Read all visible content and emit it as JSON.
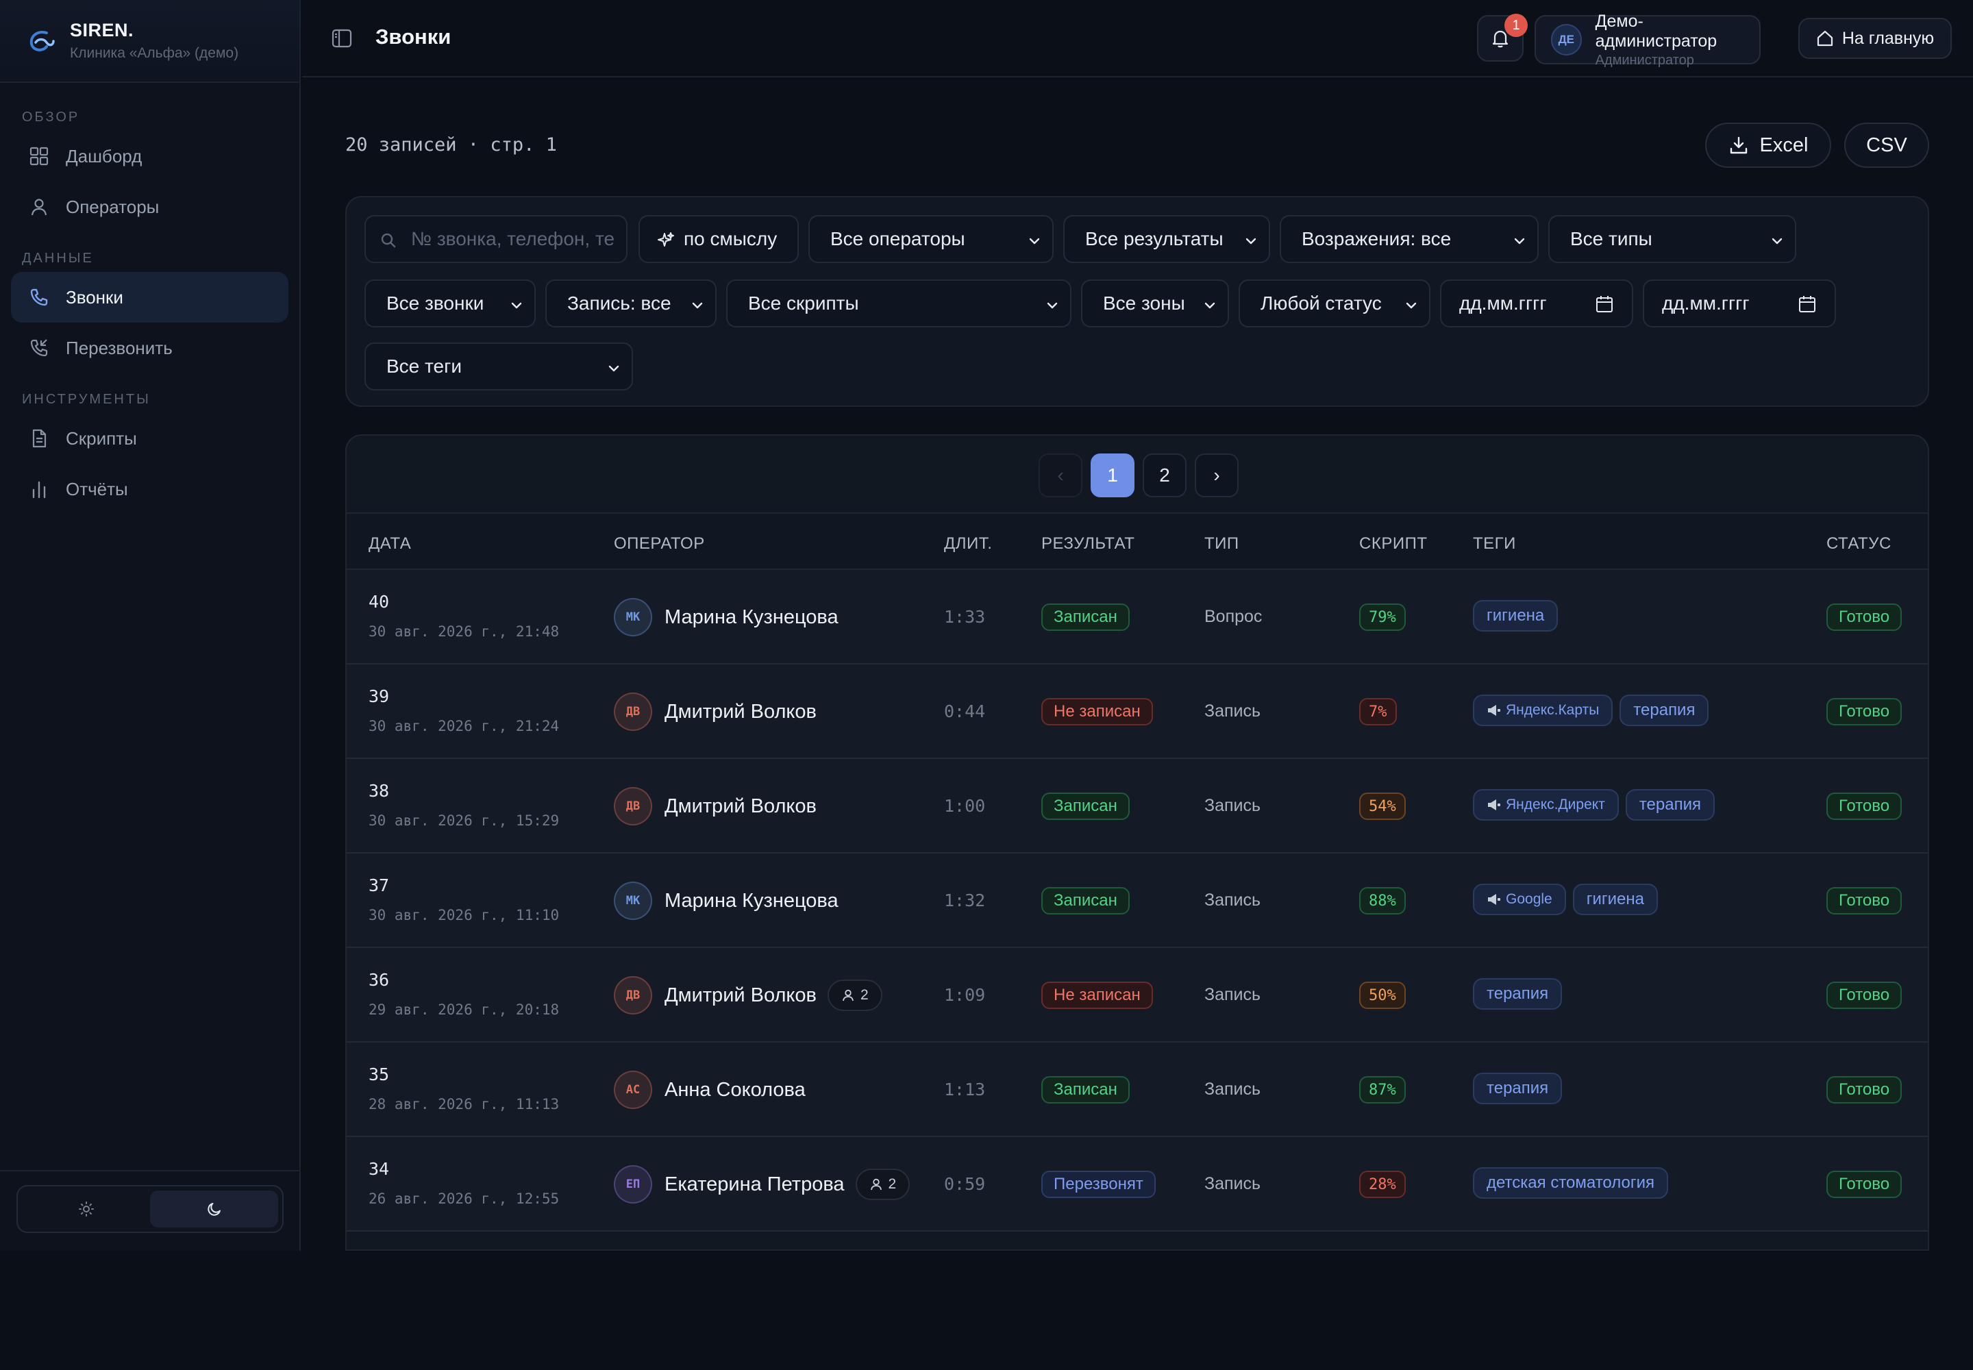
{
  "brand": {
    "name": "SIREN.",
    "subtitle": "Клиника «Альфа» (демо)"
  },
  "sidebar": {
    "sections": [
      {
        "title": "ОБЗОР",
        "items": [
          {
            "label": "Дашборд",
            "icon": "grid-icon"
          },
          {
            "label": "Операторы",
            "icon": "user-icon"
          }
        ]
      },
      {
        "title": "ДАННЫЕ",
        "items": [
          {
            "label": "Звонки",
            "icon": "phone-icon",
            "active": true
          },
          {
            "label": "Перезвонить",
            "icon": "phone-callback-icon"
          }
        ]
      },
      {
        "title": "ИНСТРУМЕНТЫ",
        "items": [
          {
            "label": "Скрипты",
            "icon": "document-icon"
          },
          {
            "label": "Отчёты",
            "icon": "bar-chart-icon"
          }
        ]
      }
    ],
    "theme": {
      "selected": "dark"
    }
  },
  "header": {
    "title": "Звонки",
    "notifications_count": "1",
    "user": {
      "initials": "ДЕ",
      "name": "Демо-администратор",
      "role": "Администратор"
    },
    "home_label": "На главную"
  },
  "toolbar": {
    "records_info": "20 записей · стр. 1",
    "excel_label": "Excel",
    "csv_label": "CSV"
  },
  "filters": {
    "search_placeholder": "№ звонка, телефон, те",
    "semantic_label": "по смыслу",
    "operators": "Все операторы",
    "results": "Все результаты",
    "objections": "Возражения: все",
    "types": "Все типы",
    "calls": "Все звонки",
    "recording": "Запись: все",
    "scripts": "Все скрипты",
    "zones": "Все зоны",
    "status": "Любой статус",
    "date_from": "дд.мм.гггг",
    "date_to": "дд.мм.гггг",
    "tags": "Все теги"
  },
  "pagination": {
    "prev": "‹",
    "pages": [
      "1",
      "2"
    ],
    "current": "1",
    "next": "›"
  },
  "table": {
    "columns": {
      "date": "ДАТА",
      "operator": "ОПЕРАТОР",
      "duration": "ДЛИТ.",
      "result": "РЕЗУЛЬТАТ",
      "type": "ТИП",
      "script": "СКРИПТ",
      "tags": "ТЕГИ",
      "status": "СТАТУС"
    },
    "rows": [
      {
        "id": "40",
        "date": "30 авг. 2026 г., 21:48",
        "initials": "МК",
        "avatar_color": "#6f9ae8",
        "operator": "Марина Кузнецова",
        "extra": "",
        "duration": "1:33",
        "result": "Записан",
        "result_color": "green",
        "type": "Вопрос",
        "script": "79%",
        "script_color": "green",
        "source": "",
        "tags": [
          "гигиена"
        ],
        "status": "Готово"
      },
      {
        "id": "39",
        "date": "30 авг. 2026 г., 21:24",
        "initials": "ДВ",
        "avatar_color": "#e0705a",
        "operator": "Дмитрий Волков",
        "extra": "",
        "duration": "0:44",
        "result": "Не записан",
        "result_color": "red",
        "type": "Запись",
        "script": "7%",
        "script_color": "red",
        "source": "Яндекс.Карты",
        "tags": [
          "терапия"
        ],
        "status": "Готово"
      },
      {
        "id": "38",
        "date": "30 авг. 2026 г., 15:29",
        "initials": "ДВ",
        "avatar_color": "#e0705a",
        "operator": "Дмитрий Волков",
        "extra": "",
        "duration": "1:00",
        "result": "Записан",
        "result_color": "green",
        "type": "Запись",
        "script": "54%",
        "script_color": "orange",
        "source": "Яндекс.Директ",
        "tags": [
          "терапия"
        ],
        "status": "Готово"
      },
      {
        "id": "37",
        "date": "30 авг. 2026 г., 11:10",
        "initials": "МК",
        "avatar_color": "#6f9ae8",
        "operator": "Марина Кузнецова",
        "extra": "",
        "duration": "1:32",
        "result": "Записан",
        "result_color": "green",
        "type": "Запись",
        "script": "88%",
        "script_color": "green",
        "source": "Google",
        "tags": [
          "гигиена"
        ],
        "status": "Готово"
      },
      {
        "id": "36",
        "date": "29 авг. 2026 г., 20:18",
        "initials": "ДВ",
        "avatar_color": "#e0705a",
        "operator": "Дмитрий Волков",
        "extra": "2",
        "duration": "1:09",
        "result": "Не записан",
        "result_color": "red",
        "type": "Запись",
        "script": "50%",
        "script_color": "orange",
        "source": "",
        "tags": [
          "терапия"
        ],
        "status": "Готово"
      },
      {
        "id": "35",
        "date": "28 авг. 2026 г., 11:13",
        "initials": "АС",
        "avatar_color": "#e0705a",
        "operator": "Анна Соколова",
        "extra": "",
        "duration": "1:13",
        "result": "Записан",
        "result_color": "green",
        "type": "Запись",
        "script": "87%",
        "script_color": "green",
        "source": "",
        "tags": [
          "терапия"
        ],
        "status": "Готово"
      },
      {
        "id": "34",
        "date": "26 авг. 2026 г., 12:55",
        "initials": "ЕП",
        "avatar_color": "#9b7ae8",
        "operator": "Екатерина Петрова",
        "extra": "2",
        "duration": "0:59",
        "result": "Перезвонят",
        "result_color": "blue",
        "type": "Запись",
        "script": "28%",
        "script_color": "red",
        "source": "",
        "tags": [
          "детская стоматология"
        ],
        "status": "Готово"
      }
    ]
  }
}
